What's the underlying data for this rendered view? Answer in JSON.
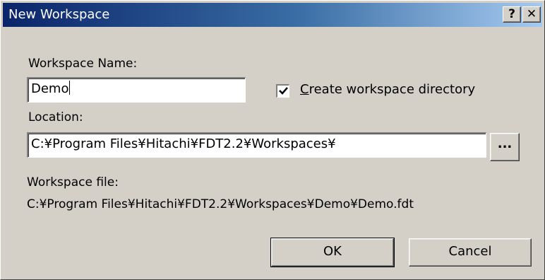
{
  "window": {
    "title": "New Workspace",
    "help_label": "?",
    "close_label": "✕"
  },
  "workspace_name": {
    "label": "Workspace Name:",
    "value": "Demo"
  },
  "create_directory": {
    "checked": true,
    "label_accel": "C",
    "label_rest": "reate workspace directory"
  },
  "location": {
    "label": "Location:",
    "value": "C:¥Program Files¥Hitachi¥FDT2.2¥Workspaces¥",
    "browse_label": "..."
  },
  "workspace_file": {
    "label": "Workspace file:",
    "path": "C:¥Program Files¥Hitachi¥FDT2.2¥Workspaces¥Demo¥Demo.fdt"
  },
  "buttons": {
    "ok": "OK",
    "cancel": "Cancel"
  },
  "colors": {
    "title_gradient_start": "#0a246a",
    "title_gradient_end": "#a6caf0",
    "dialog_face": "#d4d0c8"
  }
}
